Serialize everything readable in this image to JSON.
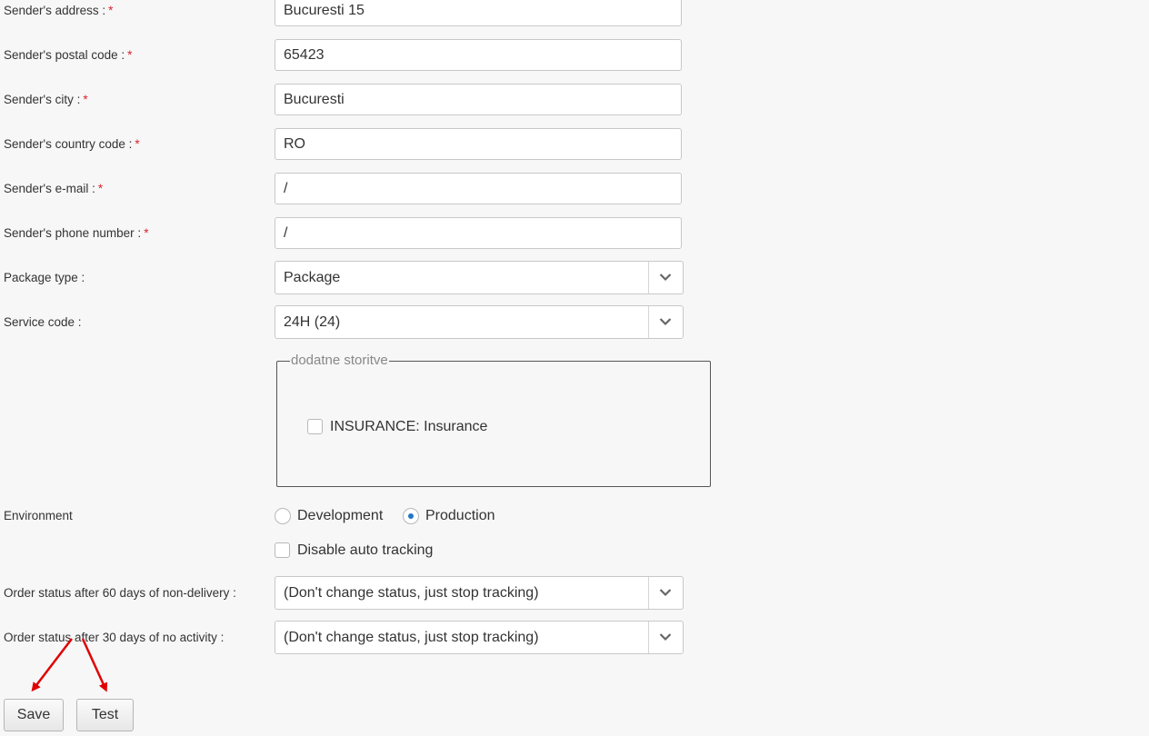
{
  "fields": [
    {
      "label": "Sender's address :",
      "required": "*",
      "value": "Bucuresti 15"
    },
    {
      "label": "Sender's postal code :",
      "required": "*",
      "value": "65423"
    },
    {
      "label": "Sender's city :",
      "required": "*",
      "value": "Bucuresti"
    },
    {
      "label": "Sender's country code :",
      "required": "*",
      "value": "RO"
    },
    {
      "label": "Sender's e-mail :",
      "required": "*",
      "value": "/"
    },
    {
      "label": "Sender's phone number :",
      "required": "*",
      "value": "/"
    }
  ],
  "package_type": {
    "label": "Package type :",
    "value": "Package"
  },
  "service_code": {
    "label": "Service code :",
    "value": "24H (24)"
  },
  "extra_services": {
    "legend": "dodatne storitve",
    "insurance_label": "INSURANCE: Insurance",
    "insurance_checked": false
  },
  "environment": {
    "label": "Environment",
    "options": [
      "Development",
      "Production"
    ],
    "selected": "Production"
  },
  "disable_auto_tracking": {
    "label": "Disable auto tracking",
    "checked": false
  },
  "status_60": {
    "label": "Order status after 60 days of non-delivery :",
    "value": "(Don't change status, just stop tracking)"
  },
  "status_30": {
    "label": "Order status after 30 days of no activity :",
    "value": "(Don't change status, just stop tracking)"
  },
  "buttons": {
    "save": "Save",
    "test": "Test"
  },
  "colors": {
    "required": "#d9232e",
    "radio_accent": "#2176c7",
    "annotation_arrow": "#e00000"
  },
  "icons": {
    "select_arrow": "chevron-down-icon",
    "annotation": "red-arrow-icon"
  }
}
